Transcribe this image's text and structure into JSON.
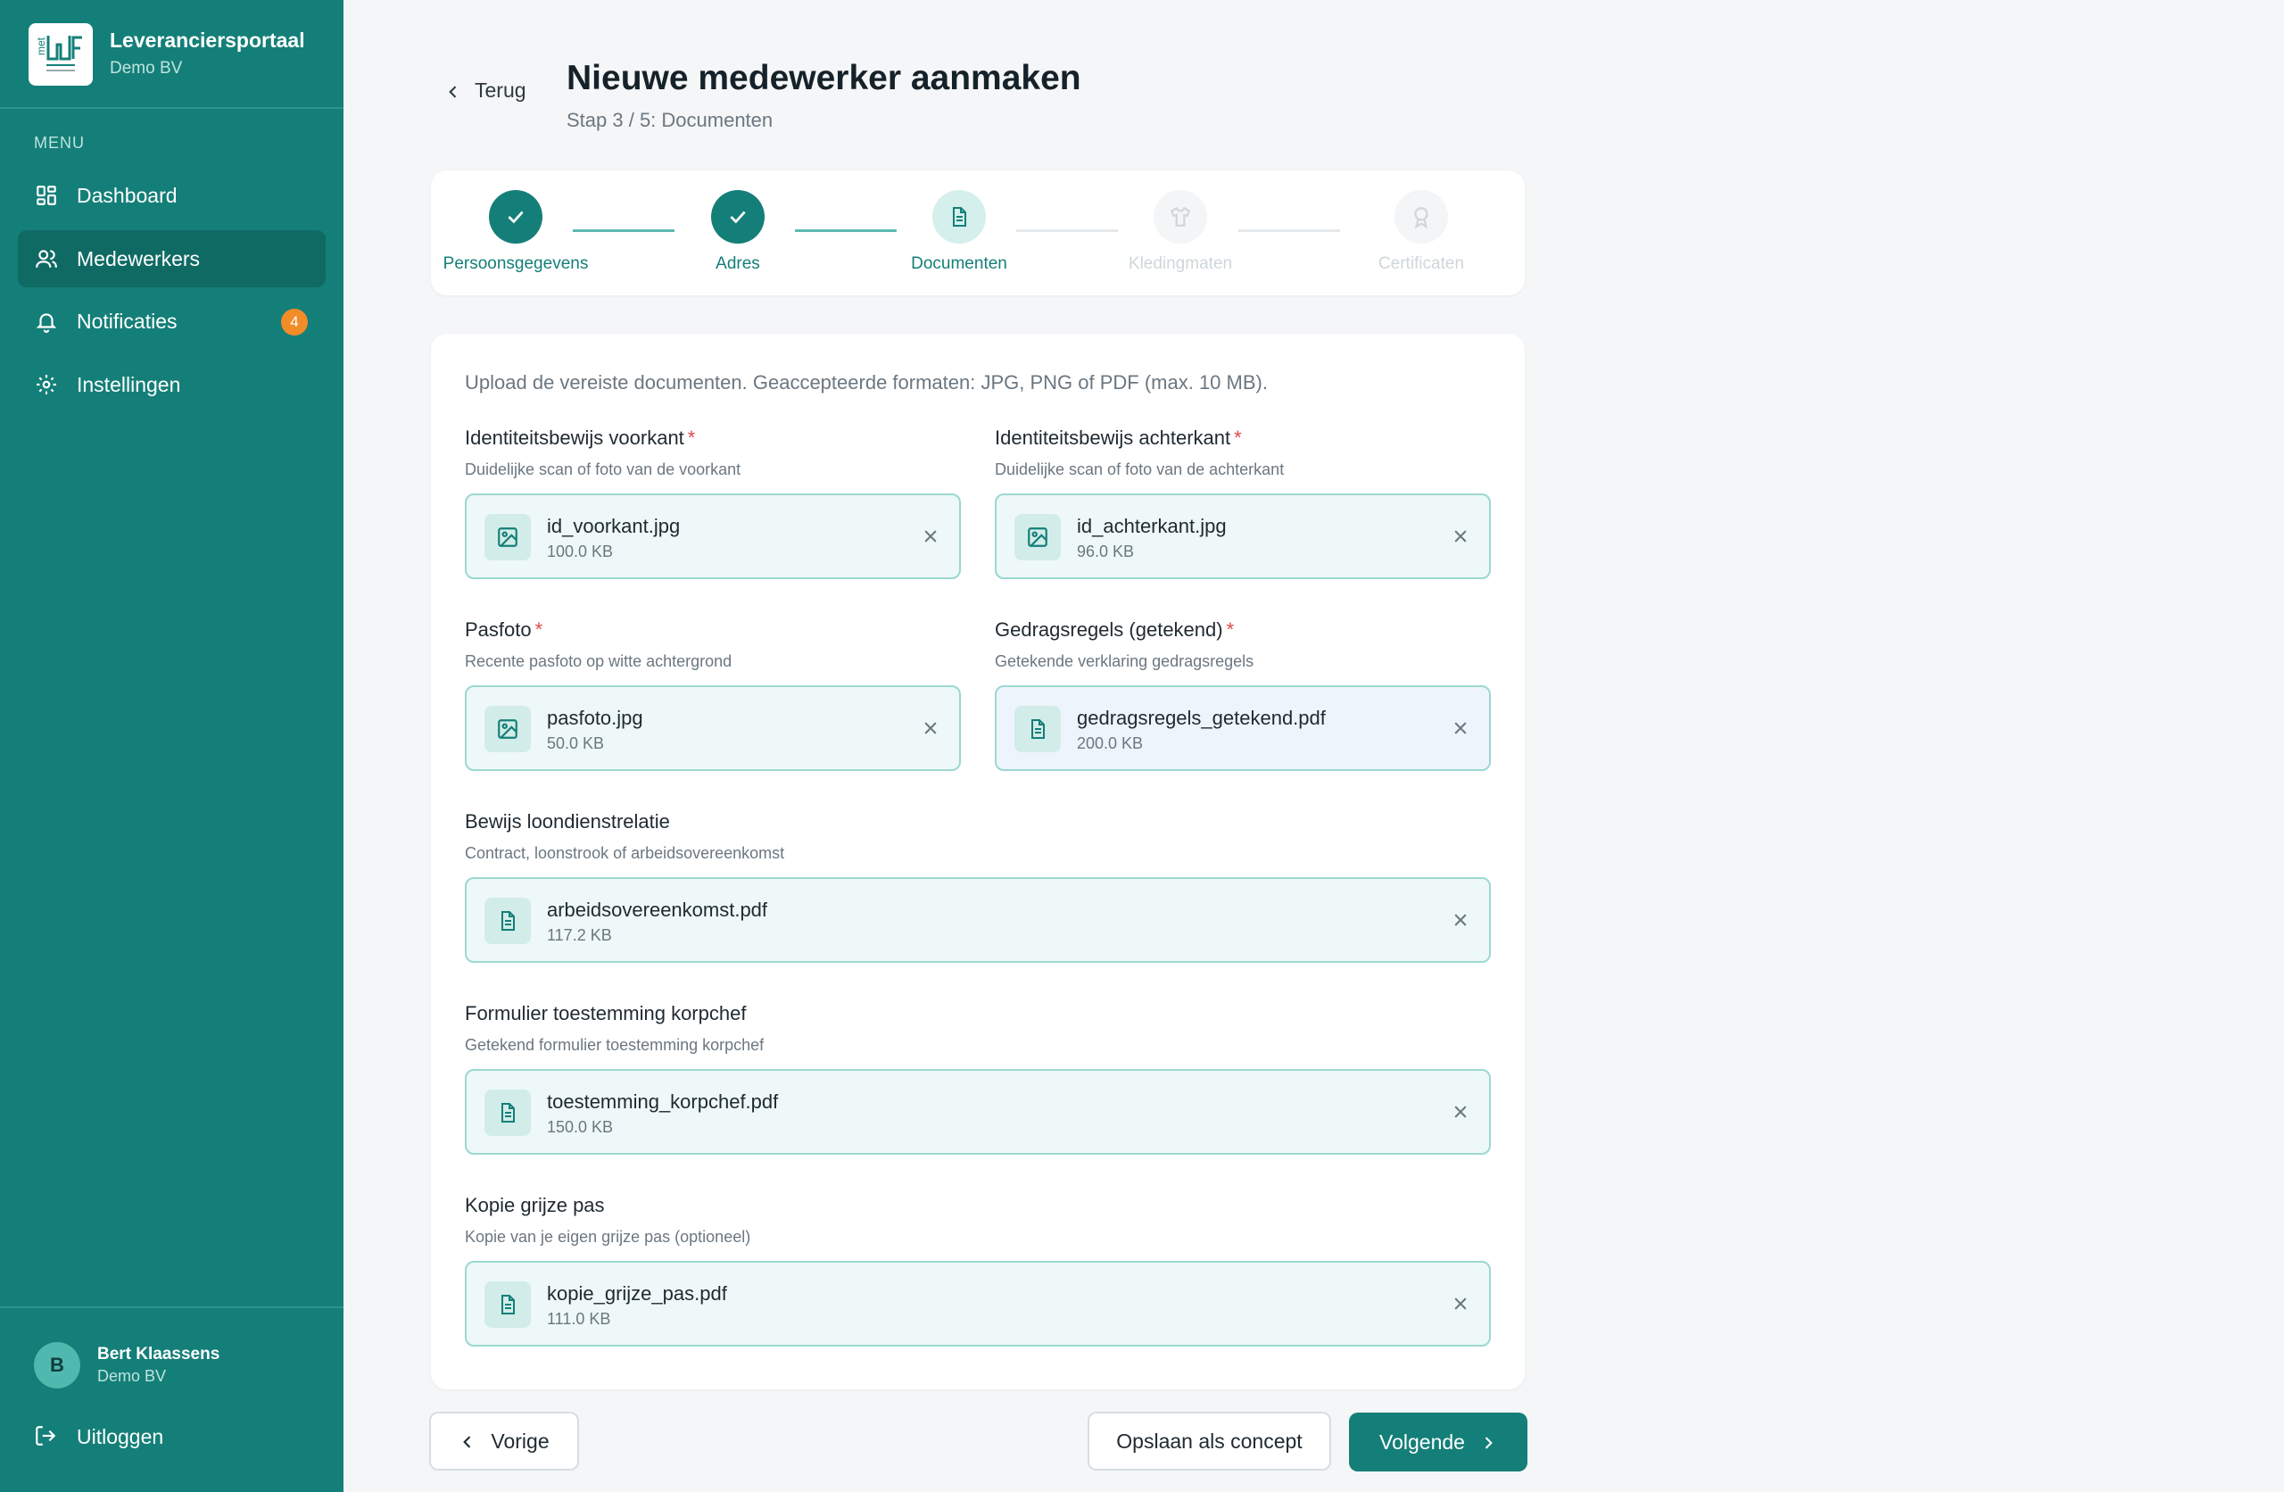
{
  "colors": {
    "primary": "#147f78",
    "badge": "#f28c28",
    "required": "#e04848"
  },
  "brand": {
    "name": "Leveranciersportaal",
    "company": "Demo BV"
  },
  "menu": {
    "title": "MENU",
    "items": [
      {
        "label": "Dashboard",
        "icon": "dashboard-icon"
      },
      {
        "label": "Medewerkers",
        "icon": "users-icon",
        "active": true
      },
      {
        "label": "Notificaties",
        "icon": "bell-icon",
        "badge": "4"
      },
      {
        "label": "Instellingen",
        "icon": "gear-icon"
      }
    ]
  },
  "user": {
    "initial": "B",
    "name": "Bert Klaassens",
    "company": "Demo BV",
    "logout": "Uitloggen"
  },
  "header": {
    "back": "Terug",
    "title": "Nieuwe medewerker aanmaken",
    "subtitle": "Stap 3 / 5: Documenten"
  },
  "steps": [
    {
      "label": "Persoonsgegevens",
      "state": "done"
    },
    {
      "label": "Adres",
      "state": "done"
    },
    {
      "label": "Documenten",
      "state": "current"
    },
    {
      "label": "Kledingmaten",
      "state": "todo"
    },
    {
      "label": "Certificaten",
      "state": "todo"
    }
  ],
  "form": {
    "intro": "Upload de vereiste documenten. Geaccepteerde formaten: JPG, PNG of PDF (max. 10 MB).",
    "fields": [
      {
        "label": "Identiteitsbewijs voorkant",
        "required": "*",
        "help": "Duidelijke scan of foto van de voorkant",
        "file": "id_voorkant.jpg",
        "size": "100.0 KB",
        "icon": "image-icon"
      },
      {
        "label": "Identiteitsbewijs achterkant",
        "required": "*",
        "help": "Duidelijke scan of foto van de achterkant",
        "file": "id_achterkant.jpg",
        "size": "96.0 KB",
        "icon": "image-icon"
      },
      {
        "label": "Pasfoto",
        "required": "*",
        "help": "Recente pasfoto op witte achtergrond",
        "file": "pasfoto.jpg",
        "size": "50.0 KB",
        "icon": "image-icon"
      },
      {
        "label": "Gedragsregels (getekend)",
        "required": "*",
        "help": "Getekende verklaring gedragsregels",
        "file": "gedragsregels_getekend.pdf",
        "size": "200.0 KB",
        "icon": "document-icon"
      },
      {
        "label": "Bewijs loondienstrelatie",
        "help": "Contract, loonstrook of arbeidsovereenkomst",
        "file": "arbeidsovereenkomst.pdf",
        "size": "117.2 KB",
        "icon": "document-icon"
      },
      {
        "label": "Formulier toestemming korpchef",
        "help": "Getekend formulier toestemming korpchef",
        "file": "toestemming_korpchef.pdf",
        "size": "150.0 KB",
        "icon": "document-icon"
      },
      {
        "label": "Kopie grijze pas",
        "help": "Kopie van je eigen grijze pas (optioneel)",
        "file": "kopie_grijze_pas.pdf",
        "size": "111.0 KB",
        "icon": "document-icon"
      }
    ]
  },
  "footer": {
    "prev": "Vorige",
    "concept": "Opslaan als concept",
    "next": "Volgende"
  }
}
